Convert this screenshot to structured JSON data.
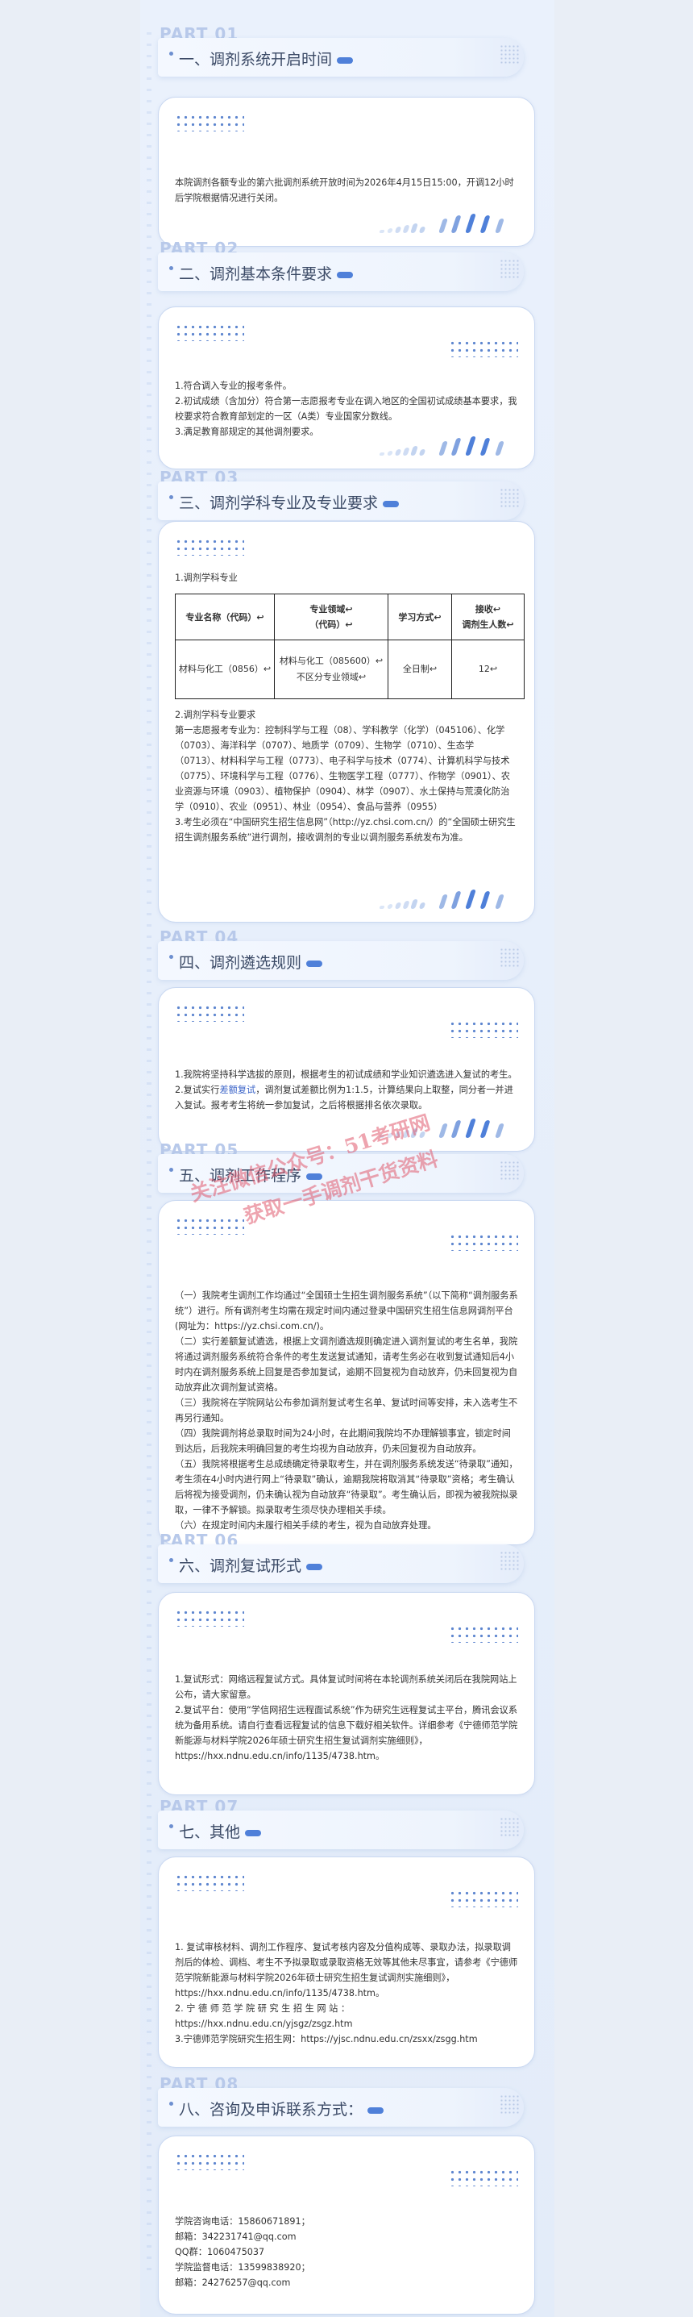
{
  "sections": [
    {
      "part": "PART 01",
      "title": "一、调剂系统开启时间",
      "paragraphs": [
        "本院调剂各额专业的第六批调剂系统开放时间为2026年4月15日15:00，开调12小时后学院根据情况进行关闭。"
      ]
    },
    {
      "part": "PART 02",
      "title": "二、调剂基本条件要求",
      "paragraphs": [
        "1.符合调入专业的报考条件。",
        "2.初试成绩（含加分）符合第一志愿报考专业在调入地区的全国初试成绩基本要求，我校要求符合教育部划定的一区（A类）专业国家分数线。",
        "3.满足教育部规定的其他调剂要求。"
      ]
    },
    {
      "part": "PART 03",
      "title": "三、调剂学科专业及专业要求",
      "intro": "1.调剂学科专业",
      "table": {
        "headers": [
          "专业名称（代码）↩",
          "专业领域↩\n（代码）↩",
          "学习方式↩",
          "接收↩\n调剂生人数↩"
        ],
        "row": [
          "材料与化工（0856）↩",
          "材料与化工（085600）↩\n不区分专业领域↩",
          "全日制↩",
          "12↩"
        ]
      },
      "paragraphs": [
        "2.调剂学科专业要求",
        "第一志愿报考专业为：控制科学与工程（08）、学科教学（化学）（045106）、化学（0703）、海洋科学（0707）、地质学（0709）、生物学（0710）、生态学（0713）、材料科学与工程（0773）、电子科学与技术（0774）、计算机科学与技术（0775）、环境科学与工程（0776）、生物医学工程（0777）、作物学（0901）、农业资源与环境（0903）、植物保护（0904）、林学（0907）、水土保持与荒漠化防治学（0910）、农业（0951）、林业（0954）、食品与营养（0955）",
        "3.考生必须在“中国研究生招生信息网”（http://yz.chsi.com.cn/）的“全国硕士研究生招生调剂服务系统”进行调剂，接收调剂的专业以调剂服务系统发布为准。"
      ]
    },
    {
      "part": "PART 04",
      "title": "四、调剂遴选规则",
      "paragraphs": [
        "1.我院将坚持科学选拔的原则，根据考生的初试成绩和学业知识遴选进入复试的考生。",
        "2.复试实行差额复试，调剂复试差额比例为1:1.5，计算结果向上取整，同分者一并进入复试。报考考生将统一参加复试，之后将根据排名依次录取。"
      ],
      "highlight": "差额复试"
    },
    {
      "part": "PART 05",
      "title": "五、调剂工作程序",
      "paragraphs": [
        "（一）我院考生调剂工作均通过“全国硕士生招生调剂服务系统”（以下简称“调剂服务系统”）进行。所有调剂考生均需在规定时间内通过登录中国研究生招生信息网调剂平台(网址为：https://yz.chsi.com.cn/)。",
        "（二）实行差额复试遴选，根据上文调剂遴选规则确定进入调剂复试的考生名单，我院将通过调剂服务系统符合条件的考生发送复试通知，请考生务必在收到复试通知后4小时内在调剂服务系统上回复是否参加复试，逾期不回复视为自动放弃，仍未回复视为自动放弃此次调剂复试资格。",
        "（三）我院将在学院网站公布参加调剂复试考生名单、复试时间等安排，未入选考生不再另行通知。",
        "（四）我院调剂将总录取时间为24小时，在此期间我院均不办理解锁事宜，锁定时间到达后，后我院未明确回复的考生均视为自动放弃，仍未回复视为自动放弃。",
        "（五）我院将根据考生总成绩确定待录取考生，并在调剂服务系统发送“待录取”通知，考生须在4小时内进行网上“待录取”确认，逾期我院将取消其“待录取”资格；考生确认后将视为接受调剂，仍未确认视为自动放弃“待录取”。考生确认后，即视为被我院拟录取，一律不予解锁。拟录取考生须尽快办理相关手续。",
        "（六）在规定时间内未履行相关手续的考生，视为自动放弃处理。"
      ]
    },
    {
      "part": "PART 06",
      "title": "六、调剂复试形式",
      "paragraphs": [
        "1.复试形式：网络远程复试方式。具体复试时间将在本轮调剂系统关闭后在我院网站上公布，请大家留意。",
        "2.复试平台：使用“学信网招生远程面试系统”作为研究生远程复试主平台，腾讯会议系统为备用系统。请自行查看远程复试的信息下载好相关软件。详细参考《宁德师范学院新能源与材料学院2026年硕士研究生招生复试调剂实施细则》，https://hxx.ndnu.edu.cn/info/1135/4738.htm。"
      ]
    },
    {
      "part": "PART 07",
      "title": "七、其他",
      "paragraphs": [
        "1. 复试审核材料、调剂工作程序、复试考核内容及分值构成等、录取办法，拟录取调剂后的体检、调档、考生不予拟录取或录取资格无效等其他未尽事宜，请参考《宁德师范学院新能源与材料学院2026年硕士研究生招生复试调剂实施细则》，https://hxx.ndnu.edu.cn/info/1135/4738.htm。",
        "2. 宁 德 师 范 学 院 研 究 生 招 生 网 站 ：https://hxx.ndnu.edu.cn/yjsgz/zsgz.htm",
        "3.宁德师范学院研究生招生网：https://yjsc.ndnu.edu.cn/zsxx/zsgg.htm"
      ]
    },
    {
      "part": "PART 08",
      "title": "八、咨询及申诉联系方式：",
      "paragraphs": [
        "学院咨询电话：15860671891；",
        "邮箱：342231741@qq.com",
        "QQ群：1060475037",
        "学院监督电话：13599838920；",
        "邮箱：24276257@qq.com"
      ]
    }
  ],
  "watermark": [
    "关注微信公众号：51考研网",
    "获取一手调剂干货资料"
  ],
  "colors": {
    "accent": "#4f80d9",
    "part_label": "#b8c9ea",
    "card_border": "#c9d8f1",
    "watermark": "#e05a6e"
  }
}
